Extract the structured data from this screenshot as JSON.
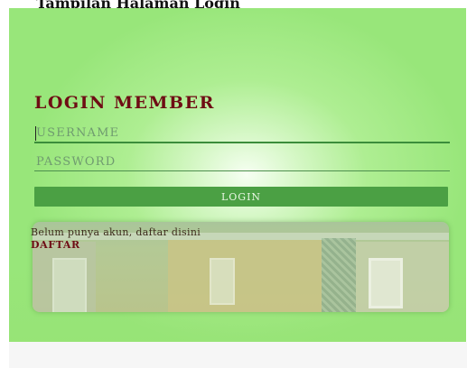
{
  "caption": "Tampilan Halaman Login",
  "login": {
    "heading": "LOGIN MEMBER",
    "username_placeholder": "USERNAME",
    "password_placeholder": "PASSWORD",
    "button_label": "LOGIN"
  },
  "register": {
    "prompt": "Belum punya akun, daftar disini",
    "link_label": "DAFTAR"
  },
  "colors": {
    "background": "#98e67a",
    "heading": "#6e0d14",
    "button": "#4ba044"
  }
}
